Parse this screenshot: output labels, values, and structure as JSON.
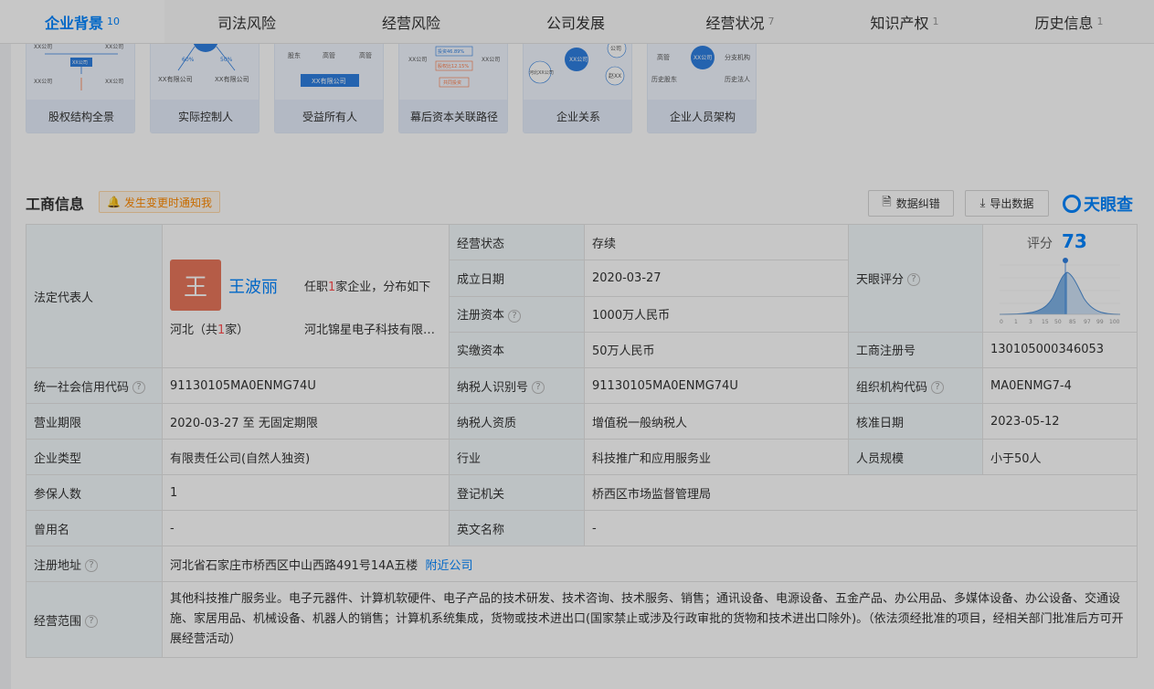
{
  "tabs": [
    {
      "label": "企业背景",
      "badge": "10"
    },
    {
      "label": "司法风险",
      "badge": ""
    },
    {
      "label": "经营风险",
      "badge": ""
    },
    {
      "label": "公司发展",
      "badge": ""
    },
    {
      "label": "经营状况",
      "badge": "7"
    },
    {
      "label": "知识产权",
      "badge": "1"
    },
    {
      "label": "历史信息",
      "badge": "1"
    }
  ],
  "cards": [
    {
      "caption": "股权结构全景",
      "thumb_text": [
        "XX公司",
        "XX公司",
        "XX公司",
        "XX公司",
        "XX公司"
      ]
    },
    {
      "caption": "实际控制人",
      "thumb_text": [
        "60%",
        "50%",
        "XX有限公司",
        "XX有限公司"
      ]
    },
    {
      "caption": "受益所有人",
      "thumb_text": [
        "股东",
        "高管",
        "高管",
        "XX有限公司"
      ]
    },
    {
      "caption": "幕后资本关联路径",
      "thumb_text": [
        "投资46.89%",
        "XX公司",
        "XX公司",
        "股权比12.15%",
        "共同投资"
      ]
    },
    {
      "caption": "企业关系",
      "thumb_text": [
        "XX公司",
        "公司",
        "河北XX公司",
        "赵XX"
      ]
    },
    {
      "caption": "企业人员架构",
      "thumb_text": [
        "XX公司",
        "高管",
        "分支机构",
        "历史股东",
        "历史法人"
      ]
    }
  ],
  "section": {
    "title": "工商信息",
    "notify": "发生变更时通知我",
    "correct_btn": "数据纠错",
    "export_btn": "导出数据",
    "logo": "天眼查"
  },
  "legal_rep": {
    "label": "法定代表人",
    "avatar_char": "王",
    "name": "王波丽",
    "post_prefix": "任职",
    "post_count": "1",
    "post_suffix": "家企业，分布如下",
    "region_prefix": "河北（共",
    "region_count": "1",
    "region_suffix": "家）",
    "company": "河北锦星电子科技有限公司"
  },
  "score": {
    "label": "天眼评分",
    "title": "评分",
    "value": "73",
    "axis": [
      "0",
      "1",
      "3",
      "15",
      "50",
      "85",
      "97",
      "99",
      "100"
    ]
  },
  "rows": {
    "status": {
      "label": "经营状态",
      "value": "存续"
    },
    "found_date": {
      "label": "成立日期",
      "value": "2020-03-27"
    },
    "reg_capital": {
      "label": "注册资本",
      "value": "1000万人民币"
    },
    "paid_capital": {
      "label": "实缴资本",
      "value": "50万人民币"
    },
    "reg_no": {
      "label": "工商注册号",
      "value": "130105000346053"
    },
    "credit_code": {
      "label": "统一社会信用代码",
      "value": "91130105MA0ENMG74U"
    },
    "taxpayer_id": {
      "label": "纳税人识别号",
      "value": "91130105MA0ENMG74U"
    },
    "org_code": {
      "label": "组织机构代码",
      "value": "MA0ENMG7-4"
    },
    "term": {
      "label": "营业期限",
      "value": "2020-03-27 至 无固定期限"
    },
    "tax_qual": {
      "label": "纳税人资质",
      "value": "增值税一般纳税人"
    },
    "approve_date": {
      "label": "核准日期",
      "value": "2023-05-12"
    },
    "company_type": {
      "label": "企业类型",
      "value": "有限责任公司(自然人独资)"
    },
    "industry": {
      "label": "行业",
      "value": "科技推广和应用服务业"
    },
    "staff_size": {
      "label": "人员规模",
      "value": "小于50人"
    },
    "insured": {
      "label": "参保人数",
      "value": "1"
    },
    "authority": {
      "label": "登记机关",
      "value": "桥西区市场监督管理局"
    },
    "former_name": {
      "label": "曾用名",
      "value": "-"
    },
    "english_name": {
      "label": "英文名称",
      "value": "-"
    },
    "address": {
      "label": "注册地址",
      "value": "河北省石家庄市桥西区中山西路491号14A五楼",
      "link": "附近公司"
    },
    "scope": {
      "label": "经营范围",
      "value": "其他科技推广服务业。电子元器件、计算机软硬件、电子产品的技术研发、技术咨询、技术服务、销售；通讯设备、电源设备、五金产品、办公用品、多媒体设备、办公设备、交通设施、家居用品、机械设备、机器人的销售；计算机系统集成，货物或技术进出口(国家禁止或涉及行政审批的货物和技术进出口除外)。（依法须经批准的项目，经相关部门批准后方可开展经营活动）"
    }
  },
  "colors": {
    "accent": "#0084ff",
    "label_bg": "#f2f9fc",
    "avatar_bg": "#e8765b",
    "notify": "#ff8a00"
  }
}
